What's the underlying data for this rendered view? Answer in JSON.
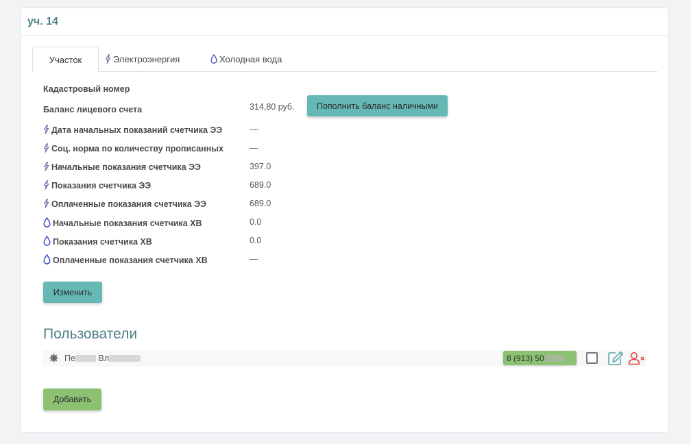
{
  "header": {
    "title": "уч. 14"
  },
  "tabs": [
    {
      "label": "Участок",
      "icon": "none"
    },
    {
      "label": "Электроэнергия",
      "icon": "lightning-icon"
    },
    {
      "label": "Холодная вода",
      "icon": "water-drop-icon"
    }
  ],
  "fields": [
    {
      "label": "Кадастровый номер",
      "value": "",
      "icon": "none"
    },
    {
      "label": "Баланс лицевого счета",
      "value": "314,80 руб.",
      "icon": "none"
    },
    {
      "label": "Дата начальных показаний счетчика ЭЭ",
      "value": "—",
      "icon": "lightning-icon"
    },
    {
      "label": "Соц. норма по количеству прописанных",
      "value": "—",
      "icon": "lightning-icon"
    },
    {
      "label": "Начальные показания счетчика ЭЭ",
      "value": "397.0",
      "icon": "lightning-icon"
    },
    {
      "label": "Показания счетчика ЭЭ",
      "value": "689.0",
      "icon": "lightning-icon"
    },
    {
      "label": "Оплаченные показания счетчика ЭЭ",
      "value": "689.0",
      "icon": "lightning-icon"
    },
    {
      "label": "Начальные показания счетчика ХВ",
      "value": "0.0",
      "icon": "water-drop-icon"
    },
    {
      "label": "Показания счетчика ХВ",
      "value": "0.0",
      "icon": "water-drop-icon"
    },
    {
      "label": "Оплаченные показания счетчика ХВ",
      "value": "—",
      "icon": "water-drop-icon"
    }
  ],
  "buttons": {
    "top_up": "Пополнить баланс наличными",
    "edit": "Изменить",
    "add": "Добавить"
  },
  "users_section": {
    "title": "Пользователи",
    "users": [
      {
        "name_part1": "Пе",
        "name_part2": "Вл",
        "phone": "8 (913) 50"
      }
    ]
  },
  "colors": {
    "accent_teal": "#66b8b4",
    "accent_green": "#8cc172",
    "title_color": "#4f7f86",
    "remove_red": "#e53935",
    "lightning_purple": "#7b5ea7",
    "drop_blue": "#3949c7"
  }
}
